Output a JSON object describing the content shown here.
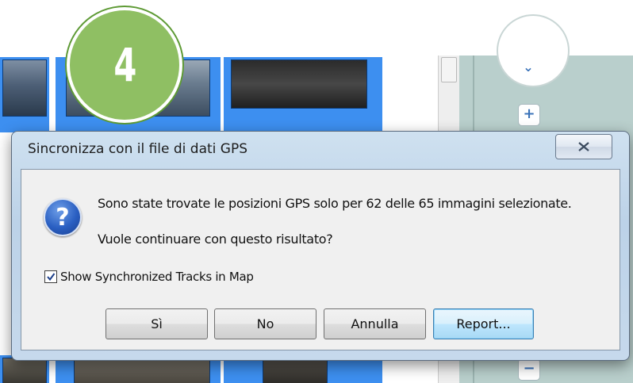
{
  "step_badge": {
    "number": "4"
  },
  "dialog": {
    "title": "Sincronizza con il file di dati GPS",
    "close_icon": "close-icon",
    "message_icon": "question-icon",
    "message_line1": "Sono state trovate le posizioni GPS solo per 62 delle 65 immagini selezionate.",
    "message_line2": "Vuole continuare con questo risultato?",
    "checkbox": {
      "label": "Show Synchronized Tracks in Map",
      "checked": true
    },
    "buttons": {
      "yes": "Sì",
      "no": "No",
      "cancel": "Annulla",
      "report": "Report..."
    }
  },
  "map_controls": {
    "zoom_in": "+",
    "zoom_out": "−",
    "nav_icon": "chevron-down-icon"
  },
  "colors": {
    "selection_blue": "#3d8ff0",
    "badge_green": "#8fbf63",
    "map_bg": "#b9cfcc"
  }
}
